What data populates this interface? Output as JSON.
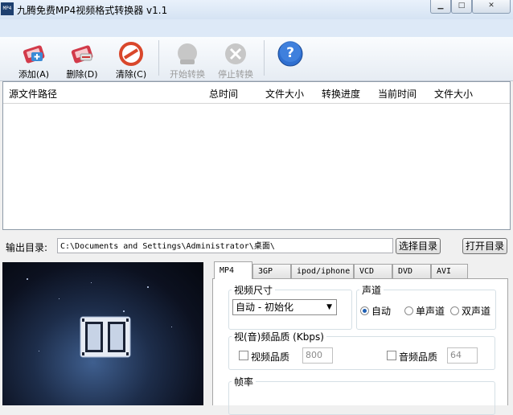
{
  "window": {
    "title": "九腾免费MP4视频格式转换器 v1.1",
    "app_icon_text": "MP4",
    "minimize_glyph": "▁",
    "maximize_glyph": "□",
    "close_glyph": "✕"
  },
  "toolbar": {
    "add_label": "添加(A)",
    "delete_label": "删除(D)",
    "clear_label": "清除(C)",
    "start_label": "开始转换",
    "stop_label": "停止转换",
    "help_glyph": "?"
  },
  "file_list": {
    "columns": [
      "源文件路径",
      "总时间",
      "文件大小",
      "转换进度",
      "当前时间",
      "文件大小"
    ],
    "rows": []
  },
  "output": {
    "label": "输出目录:",
    "path": "C:\\Documents and Settings\\Administrator\\桌面\\",
    "select_button": "选择目录",
    "open_button": "打开目录"
  },
  "tabs": [
    "MP4",
    "3GP",
    "ipod/iphone",
    "VCD",
    "DVD",
    "AVI"
  ],
  "active_tab": "MP4",
  "settings": {
    "video_size_title": "视频尺寸",
    "video_size_value": "自动 - 初始化",
    "channel_title": "声道",
    "channel_options": [
      "自动",
      "单声道",
      "双声道"
    ],
    "channel_selected": "自动",
    "quality_title": "视(音)频品质 (Kbps)",
    "video_quality_label": "视频品质",
    "video_quality_value": "800",
    "audio_quality_label": "音频品质",
    "audio_quality_value": "64",
    "framerate_title": "帧率"
  },
  "colors": {
    "add_icon": "#d23a4a",
    "clear_icon": "#d9472b",
    "help_icon": "#2f6fd0",
    "disabled_icon": "#c7c7c7"
  }
}
